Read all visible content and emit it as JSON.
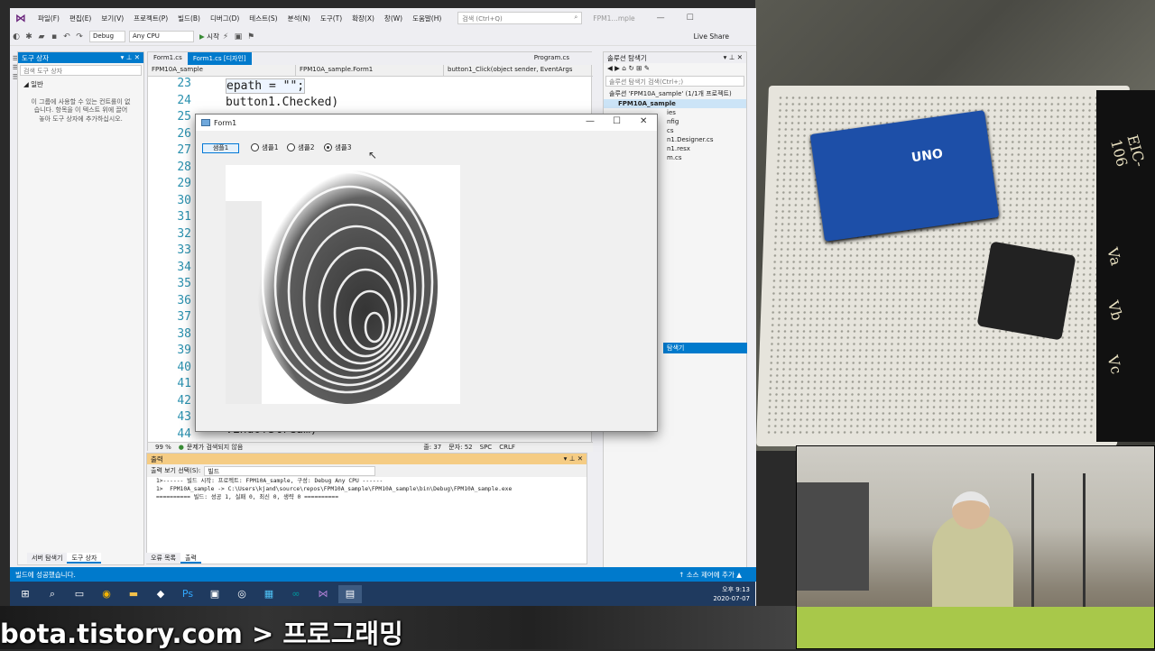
{
  "vs": {
    "logo": "⋈",
    "menus": [
      "파일(F)",
      "편집(E)",
      "보기(V)",
      "프로젝트(P)",
      "빌드(B)",
      "디버그(D)",
      "테스트(S)",
      "분석(N)",
      "도구(T)",
      "확장(X)",
      "창(W)",
      "도움말(H)"
    ],
    "search_placeholder": "검색 (Ctrl+Q)",
    "window_title": "FPM1…mple",
    "toolbar": {
      "config": "Debug",
      "platform": "Any CPU",
      "start": "시작",
      "liveshare": "Live Share"
    }
  },
  "toolbox": {
    "title": "도구 상자",
    "search_placeholder": "검색 도구 상자",
    "group": "◢ 일반",
    "message": "이 그룹에 사용할 수 있는 컨트롤이 없습니다. 항목을 이 텍스트 위에 끌어 놓아 도구 상자에 추가하십시오.",
    "strip": [
      "서버 탐색기",
      "도구 상자"
    ]
  },
  "editor": {
    "tabs": [
      "Form1.cs",
      "Form1.cs [디자인]",
      "Program.cs"
    ],
    "nav": [
      "FPM10A_sample",
      "FPM10A_sample.Form1",
      "button1_Click(object sender, EventArgs"
    ],
    "line_numbers": [
      "23",
      "24",
      "25",
      "26",
      "27",
      "28",
      "29",
      "30",
      "31",
      "32",
      "33",
      "34",
      "35",
      "36",
      "37",
      "38",
      "39",
      "40",
      "41",
      "42",
      "43",
      "44"
    ],
    "code_line_23": "epath = \"\";",
    "code_line_24": "button1.Checked)",
    "code_line_44": ".EndOfStream)",
    "status": {
      "zoom": "99 %",
      "issues": "문제가 검색되지 않음",
      "line": "줄: 37",
      "col": "문자: 52",
      "spc": "SPC",
      "crlf": "CRLF"
    }
  },
  "form1": {
    "title": "Form1",
    "button": "샘플1",
    "radios": [
      "샘플1",
      "샘플2",
      "샘플3"
    ],
    "checked_index": 2
  },
  "solution": {
    "title": "솔루션 탐색기",
    "search_placeholder": "솔루션 탐색기 검색(Ctrl+;)",
    "rows": [
      "솔루션 'FPM10A_sample' (1/1개 프로젝트)",
      "FPM10A_sample",
      "ies",
      "nfig",
      "cs",
      "n1.Designer.cs",
      "n1.resx",
      "m.cs"
    ],
    "props_tab": "탐색기"
  },
  "output": {
    "title": "출력",
    "label": "출력 보기 선택(S):",
    "source": "빌드",
    "lines": [
      "1>------ 빌드 시작: 프로젝트: FPM10A_sample, 구성: Debug Any CPU ------",
      "1>  FPM10A_sample -> C:\\Users\\kjand\\source\\repos\\FPM10A_sample\\FPM10A_sample\\bin\\Debug\\FPM10A_sample.exe",
      "========== 빌드: 성공 1, 실패 0, 최신 0, 생략 0 =========="
    ],
    "tabs": [
      "오류 목록",
      "출력"
    ]
  },
  "statusbar": {
    "left": "빌드에 성공했습니다.",
    "right": "↑ 소스 제어에 추가 ▲"
  },
  "taskbar": {
    "time": "오후 9:13",
    "date": "2020-07-07"
  },
  "photo": {
    "board_label": "UNO",
    "panel_text": [
      "EIC-106",
      "Va",
      "Vb",
      "Vc"
    ]
  },
  "watermark": "bota.tistory.com > 프로그래밍"
}
